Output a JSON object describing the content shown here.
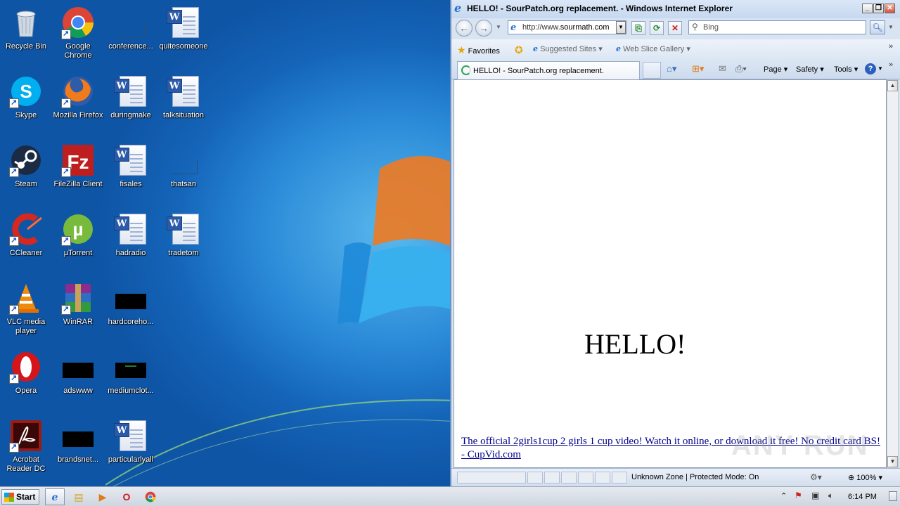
{
  "desktop": {
    "icons": [
      {
        "label": "Recycle Bin",
        "kind": "recycle-bin"
      },
      {
        "label": "Google Chrome",
        "kind": "chrome"
      },
      {
        "label": "conference...",
        "kind": "blank"
      },
      {
        "label": "quitesomeone",
        "kind": "word-doc"
      },
      {
        "label": "Skype",
        "kind": "skype"
      },
      {
        "label": "Mozilla Firefox",
        "kind": "firefox"
      },
      {
        "label": "duringmake",
        "kind": "word-doc"
      },
      {
        "label": "talksituation",
        "kind": "word-doc"
      },
      {
        "label": "Steam",
        "kind": "steam"
      },
      {
        "label": "FileZilla Client",
        "kind": "filezilla"
      },
      {
        "label": "fisales",
        "kind": "word-doc"
      },
      {
        "label": "thatsan",
        "kind": "blank"
      },
      {
        "label": "CCleaner",
        "kind": "ccleaner"
      },
      {
        "label": "µTorrent",
        "kind": "utorrent"
      },
      {
        "label": "hadradio",
        "kind": "word-doc"
      },
      {
        "label": "tradetom",
        "kind": "word-doc"
      },
      {
        "label": "VLC media player",
        "kind": "vlc"
      },
      {
        "label": "WinRAR",
        "kind": "winrar"
      },
      {
        "label": "hardcoreho...",
        "kind": "black-thumb"
      },
      {
        "label": "Opera",
        "kind": "opera"
      },
      {
        "label": "adswww",
        "kind": "black-thumb"
      },
      {
        "label": "mediumclot...",
        "kind": "black-thumb"
      },
      {
        "label": "Acrobat Reader DC",
        "kind": "acrobat"
      },
      {
        "label": "brandsnet...",
        "kind": "black-thumb"
      },
      {
        "label": "particularlyall",
        "kind": "word-doc"
      }
    ]
  },
  "ie": {
    "title": "HELLO! - SourPatch.org replacement. - Windows Internet Explorer",
    "window_buttons": {
      "minimize": "_",
      "restore": "❐",
      "close": "✕"
    },
    "address": {
      "prefix": "http://www.",
      "domain": "sourmath.com"
    },
    "search_placeholder": "Bing",
    "favorites": {
      "favorites_label": "Favorites",
      "suggested_sites": "Suggested Sites ▾",
      "web_slice_gallery": "Web Slice Gallery ▾"
    },
    "tab_label": "HELLO! - SourPatch.org replacement.",
    "command_bar": {
      "page": "Page ▾",
      "safety": "Safety ▾",
      "tools": "Tools ▾",
      "help": "?"
    },
    "content": {
      "heading": "HELLO!",
      "link_text": "The official 2girls1cup 2 girls 1 cup video! Watch it online, or download it free! No credit card BS! - CupVid.com"
    },
    "status": {
      "zone": "Unknown Zone | Protected Mode: On",
      "zoom": "100%"
    }
  },
  "watermark": "ANY RUN",
  "taskbar": {
    "start_label": "Start",
    "clock": "6:14 PM"
  }
}
